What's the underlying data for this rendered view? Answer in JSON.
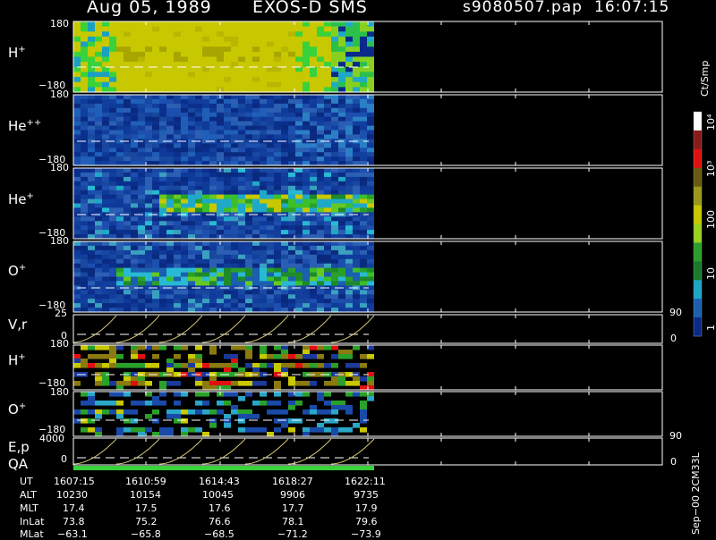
{
  "header": {
    "date": "Aug 05, 1989",
    "instrument": "EXOS-D SMS",
    "file": "s9080507.pap",
    "time": "16:07:15"
  },
  "panels": [
    {
      "label_main": "H",
      "label_sup": "+",
      "ymax": "180",
      "ymin": "−180"
    },
    {
      "label_main": "He",
      "label_sup": "++",
      "ymax": "180",
      "ymin": "−180"
    },
    {
      "label_main": "He",
      "label_sup": "+",
      "ymax": "180",
      "ymin": "−180"
    },
    {
      "label_main": "O",
      "label_sup": "+",
      "ymax": "180",
      "ymin": "−180"
    },
    {
      "label_main": "V,r",
      "label_sup": "",
      "ymax": "25",
      "ymin": "0",
      "right_top": "90",
      "right_bottom": "0"
    },
    {
      "label_main": "H",
      "label_sup": "+",
      "ymax": "180",
      "ymin": "−180"
    },
    {
      "label_main": "O",
      "label_sup": "+",
      "ymax": "180",
      "ymin": "−180"
    },
    {
      "label_main": "E,p",
      "label_sup": "",
      "ymax": "4000",
      "ymin": "0",
      "right_top": "90",
      "right_bottom": "0"
    }
  ],
  "qa_label": "QA",
  "colorbar": {
    "unit": "Ct/Smp",
    "ticks": [
      "10⁴",
      "10³",
      "100",
      "10",
      "1"
    ]
  },
  "footer": {
    "rows": [
      {
        "name": "UT",
        "values": [
          "1607:15",
          "1610:59",
          "1614:43",
          "1618:27",
          "1622:11"
        ]
      },
      {
        "name": "ALT",
        "values": [
          "10230",
          "10154",
          "10045",
          "9906",
          "9735"
        ]
      },
      {
        "name": "MLT",
        "values": [
          "17.4",
          "17.5",
          "17.6",
          "17.7",
          "17.9"
        ]
      },
      {
        "name": "InLat",
        "values": [
          "73.8",
          "75.2",
          "76.6",
          "78.1",
          "79.6"
        ]
      },
      {
        "name": "MLat",
        "values": [
          "−63.1",
          "−65.8",
          "−68.5",
          "−71.2",
          "−73.9"
        ]
      }
    ],
    "stamp": "Sep−00 2CM33L"
  },
  "colors": {
    "bg": "#000000",
    "frame": "#ffffff",
    "yellow": "#c8c800",
    "navy": "#0a2a8a",
    "green": "#3ad23a",
    "line": "#d8c878"
  },
  "chart_data": {
    "type": "heatmap",
    "x_labels": [
      "1607:15",
      "1610:59",
      "1614:43",
      "1618:27",
      "1622:11"
    ],
    "panels": [
      "H+",
      "He++",
      "He+",
      "O+",
      "V,r",
      "H+",
      "O+",
      "E,p"
    ],
    "colorbar_ticks": [
      "10⁴",
      "10³",
      "100",
      "10",
      "1"
    ],
    "colorbar_unit": "Ct/Smp",
    "data_coverage_fraction": 0.51
  }
}
